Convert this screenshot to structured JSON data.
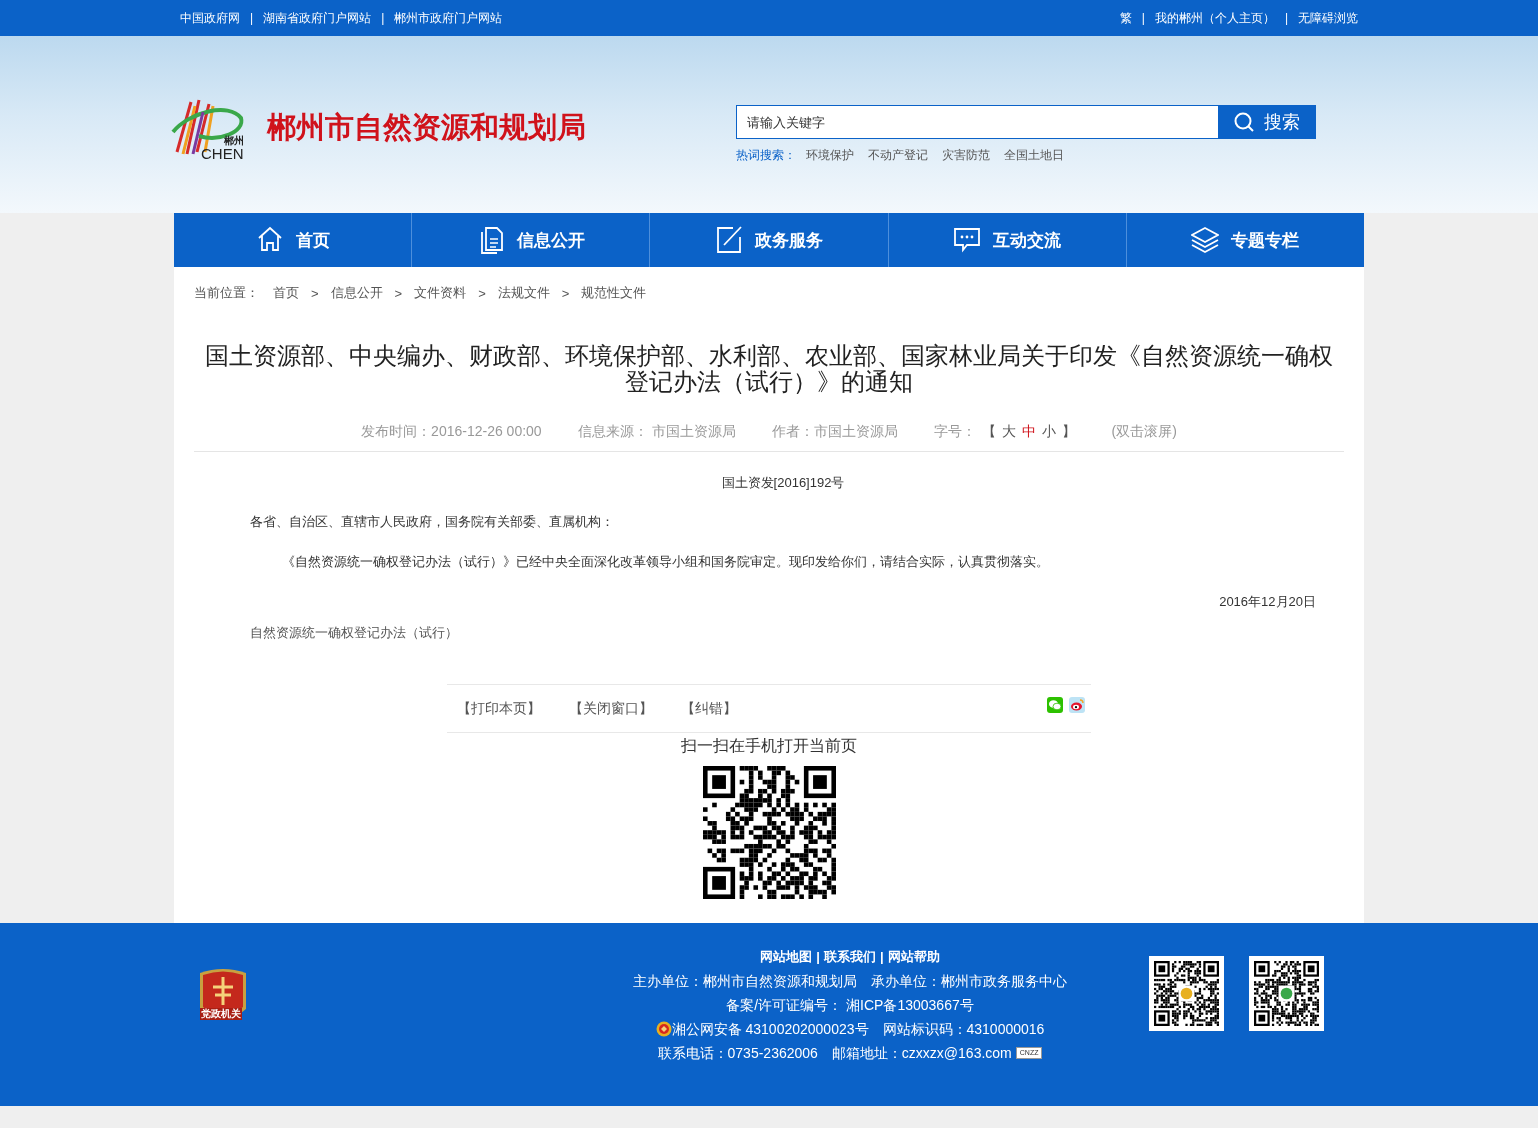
{
  "top_bar": {
    "separator": "|",
    "left_links": [
      "中国政府网",
      "湖南省政府门户网站",
      "郴州市政府门户网站"
    ],
    "right_links": [
      "繁",
      "我的郴州（个人主页）",
      "无障碍浏览"
    ]
  },
  "header": {
    "logo_text": [
      "郴州",
      "CHEN"
    ],
    "site_title": "郴州市自然资源和规划局",
    "search": {
      "placeholder": "请输入关键字",
      "button": "搜索"
    },
    "hot_label": "热词搜索：",
    "hot_words": [
      "环境保护",
      "不动产登记",
      "灾害防范",
      "全国土地日"
    ]
  },
  "nav": [
    {
      "label": "首页"
    },
    {
      "label": "信息公开"
    },
    {
      "label": "政务服务"
    },
    {
      "label": "互动交流"
    },
    {
      "label": "专题专栏"
    }
  ],
  "breadcrumb": {
    "label": "当前位置：",
    "items": [
      "首页",
      "信息公开",
      "文件资料",
      "法规文件",
      "规范性文件"
    ],
    "separator": ">"
  },
  "article": {
    "title": "国土资源部、中央编办、财政部、环境保护部、水利部、农业部、国家林业局关于印发《自然资源统一确权登记办法（试行）》的通知",
    "meta": {
      "published": "发布时间：2016-12-26 00:00",
      "source": "信息来源： 市国土资源局",
      "author": "作者：市国土资源局",
      "font_label": "字号：",
      "bracket_open": "【",
      "bracket_close": "】",
      "font_sizes": [
        {
          "label": "大",
          "selected": false
        },
        {
          "label": "中",
          "selected": true
        },
        {
          "label": "小",
          "selected": false
        }
      ],
      "scroll": "(双击滚屏)"
    },
    "doc_number": "国土资发[2016]192号",
    "paragraphs": [
      {
        "kind": "salutation",
        "text": "各省、自治区、直辖市人民政府，国务院有关部委、直属机构："
      },
      {
        "kind": "indent",
        "text": "《自然资源统一确权登记办法（试行）》已经中央全面深化改革领导小组和国务院审定。现印发给你们，请结合实际，认真贯彻落实。"
      },
      {
        "kind": "date",
        "text": "2016年12月20日"
      },
      {
        "kind": "attachment",
        "text": "自然资源统一确权登记办法（试行）"
      }
    ],
    "actions": [
      "【打印本页】",
      "【关闭窗口】",
      "【纠错】"
    ],
    "qr_caption": "扫一扫在手机打开当前页"
  },
  "footer": {
    "emblem_text": "党政机关",
    "links": [
      "网站地图",
      "联系我们",
      "网站帮助"
    ],
    "link_separator": "|",
    "sponsor": "主办单位：郴州市自然资源和规划局",
    "organizer": "承办单位：郴州市政务服务中心",
    "icp": "备案/许可证编号： 湘ICP备13003667号",
    "police": "湘公网安备 43100202000023号",
    "site_code": "网站标识码：4310000016",
    "phone": "联系电话：0735-2362006",
    "email": "邮箱地址：czxxzx@163.com",
    "stat_badge": "CNZZ"
  }
}
